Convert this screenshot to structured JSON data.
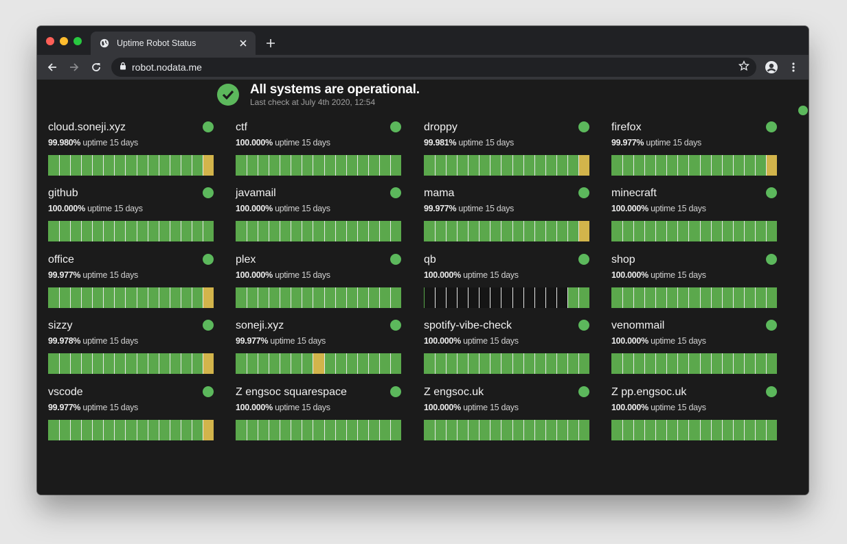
{
  "browser": {
    "tab_title": "Uptime Robot Status",
    "url": "robot.nodata.me"
  },
  "summary": {
    "title": "All systems are operational.",
    "subtitle": "Last check at July 4th 2020, 12:54"
  },
  "uptime_label": "uptime 15 days",
  "colors": {
    "up": "#5ba84c",
    "warn": "#d2b44b",
    "none": "#151515",
    "status_dot": "#5cb85c"
  },
  "monitors": [
    {
      "name": "cloud.soneji.xyz",
      "uptime": "99.980%",
      "bars": "uuuuuuuuuuuuuuw"
    },
    {
      "name": "ctf",
      "uptime": "100.000%",
      "bars": "uuuuuuuuuuuuuuu"
    },
    {
      "name": "droppy",
      "uptime": "99.981%",
      "bars": "uuuuuuuuuuuuuuw"
    },
    {
      "name": "firefox",
      "uptime": "99.977%",
      "bars": "uuuuuuuuuuuuuuw"
    },
    {
      "name": "github",
      "uptime": "100.000%",
      "bars": "uuuuuuuuuuuuuuu"
    },
    {
      "name": "javamail",
      "uptime": "100.000%",
      "bars": "uuuuuuuuuuuuuuu"
    },
    {
      "name": "mama",
      "uptime": "99.977%",
      "bars": "uuuuuuuuuuuuuuw"
    },
    {
      "name": "minecraft",
      "uptime": "100.000%",
      "bars": "uuuuuuuuuuuuuuu"
    },
    {
      "name": "office",
      "uptime": "99.977%",
      "bars": "uuuuuuuuuuuuuuw"
    },
    {
      "name": "plex",
      "uptime": "100.000%",
      "bars": "uuuuuuuuuuuuuuu"
    },
    {
      "name": "qb",
      "uptime": "100.000%",
      "bars": "nnnnnnnnnnnnnuu"
    },
    {
      "name": "shop",
      "uptime": "100.000%",
      "bars": "uuuuuuuuuuuuuuu"
    },
    {
      "name": "sizzy",
      "uptime": "99.978%",
      "bars": "uuuuuuuuuuuuuuw"
    },
    {
      "name": "soneji.xyz",
      "uptime": "99.977%",
      "bars": "uuuuuuuwuuuuuuu"
    },
    {
      "name": "spotify-vibe-check",
      "uptime": "100.000%",
      "bars": "uuuuuuuuuuuuuuu"
    },
    {
      "name": "venommail",
      "uptime": "100.000%",
      "bars": "uuuuuuuuuuuuuuu"
    },
    {
      "name": "vscode",
      "uptime": "99.977%",
      "bars": "uuuuuuuuuuuuuuw"
    },
    {
      "name": "Z engsoc squarespace",
      "uptime": "100.000%",
      "bars": "uuuuuuuuuuuuuuu"
    },
    {
      "name": "Z engsoc.uk",
      "uptime": "100.000%",
      "bars": "uuuuuuuuuuuuuuu"
    },
    {
      "name": "Z pp.engsoc.uk",
      "uptime": "100.000%",
      "bars": "uuuuuuuuuuuuuuu"
    }
  ]
}
